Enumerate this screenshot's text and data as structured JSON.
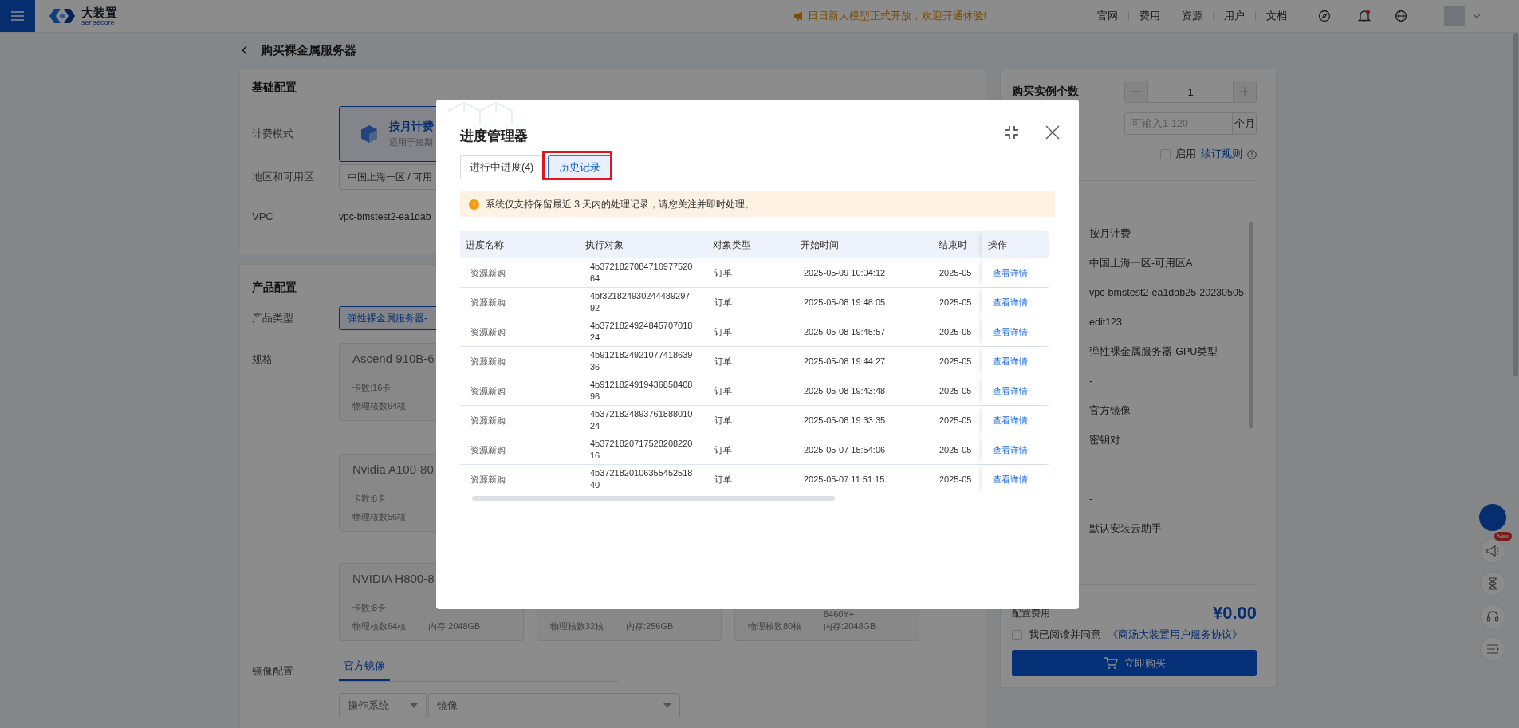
{
  "topbar": {
    "logo_title": "大装置",
    "logo_subtitle": "sensecore",
    "notice": "日日新大模型正式开放，欢迎开通体验!",
    "nav": [
      "官网",
      "费用",
      "资源",
      "用户",
      "文档"
    ]
  },
  "page": {
    "title": "购买裸金属服务器"
  },
  "basic": {
    "title": "基础配置",
    "billing_label": "计费模式",
    "billing_option": {
      "title": "按月计费",
      "desc": "适用于短期",
      "selected": true
    },
    "region_label": "地区和可用区",
    "region_value": "中国上海一区 / 可用",
    "vpc_label": "VPC",
    "vpc_value": "vpc-bmstest2-ea1dab"
  },
  "product": {
    "title": "产品配置",
    "type_label": "产品类型",
    "type_option": {
      "label": "弹性裸金属服务器-",
      "selected": true
    },
    "spec_label": "规格",
    "spec_rows": [
      [
        {
          "title": "Ascend 910B-6",
          "card_count": "卡数:16卡",
          "cores": "物理核数64核"
        }
      ],
      [
        {
          "title": "Nvidia A100-80",
          "card_count": "卡数:8卡",
          "cores": "物理核数56核"
        }
      ],
      [
        {
          "title": "NVIDIA H800-8",
          "card_count": "卡数:8卡",
          "cores": "物理核数64核",
          "memory": "内存:2048GB"
        },
        {
          "cores": "物理核数32核",
          "memory": "内存:256GB"
        },
        {
          "cpu": "8460Y+",
          "cores": "物理核数80核",
          "memory": "内存:2048GB"
        }
      ]
    ],
    "image_label": "镜像配置",
    "image_tabs": [
      {
        "label": "官方镜像",
        "selected": true
      }
    ],
    "os_select": "操作系统",
    "image_select": "镜像"
  },
  "order": {
    "count_label": "购买实例个数",
    "count_value": "1",
    "duration_placeholder": "可输入1-120",
    "duration_unit": "个月",
    "auto_renew": {
      "label": "启用",
      "checked": false
    },
    "renew_rule": "续订规则",
    "summary": [
      "按月计费",
      "中国上海一区-可用区A",
      "vpc-bmstest2-ea1dab25-20230505-edit123",
      "弹性裸金属服务器-GPU类型",
      "-",
      "官方镜像",
      "密钥对",
      "-",
      "-",
      "默认安装云助手"
    ],
    "fee_label": "配置费用",
    "fee": "¥0.00",
    "agree": {
      "text": "我已阅读并同意",
      "link": "《商汤大装置用户服务协议》",
      "checked": false
    },
    "buy": "立即购买"
  },
  "side": {
    "badge": "New"
  },
  "modal": {
    "title": "进度管理器",
    "tabs": [
      {
        "label": "进行中进度(4)",
        "selected": false
      },
      {
        "label": "历史记录",
        "selected": true
      }
    ],
    "alert": "系统仅支持保留最近 3 天内的处理记录，请您关注并即时处理。",
    "columns": [
      "进度名称",
      "执行对象",
      "对象类型",
      "开始时间",
      "结束时",
      "操作"
    ],
    "rows": [
      {
        "name": "资源新购",
        "target": "4b372182708471697752064",
        "type": "订单",
        "start": "2025-05-09 10:04:12",
        "end": "2025-05",
        "action": "查看详情"
      },
      {
        "name": "资源新购",
        "target": "4bf32182493024448929792",
        "type": "订单",
        "start": "2025-05-08 19:48:05",
        "end": "2025-05",
        "action": "查看详情"
      },
      {
        "name": "资源新购",
        "target": "4b372182492484570701824",
        "type": "订单",
        "start": "2025-05-08 19:45:57",
        "end": "2025-05",
        "action": "查看详情"
      },
      {
        "name": "资源新购",
        "target": "4b912182492107741863936",
        "type": "订单",
        "start": "2025-05-08 19:44:27",
        "end": "2025-05",
        "action": "查看详情"
      },
      {
        "name": "资源新购",
        "target": "4b912182491943685840896",
        "type": "订单",
        "start": "2025-05-08 19:43:48",
        "end": "2025-05",
        "action": "查看详情"
      },
      {
        "name": "资源新购",
        "target": "4b372182489376188801024",
        "type": "订单",
        "start": "2025-05-08 19:33:35",
        "end": "2025-05",
        "action": "查看详情"
      },
      {
        "name": "资源新购",
        "target": "4b372182071752820822016",
        "type": "订单",
        "start": "2025-05-07 15:54:06",
        "end": "2025-05",
        "action": "查看详情"
      },
      {
        "name": "资源新购",
        "target": "4b372182010635545251840",
        "type": "订单",
        "start": "2025-05-07 11:51:15",
        "end": "2025-05",
        "action": "查看详情"
      }
    ]
  }
}
